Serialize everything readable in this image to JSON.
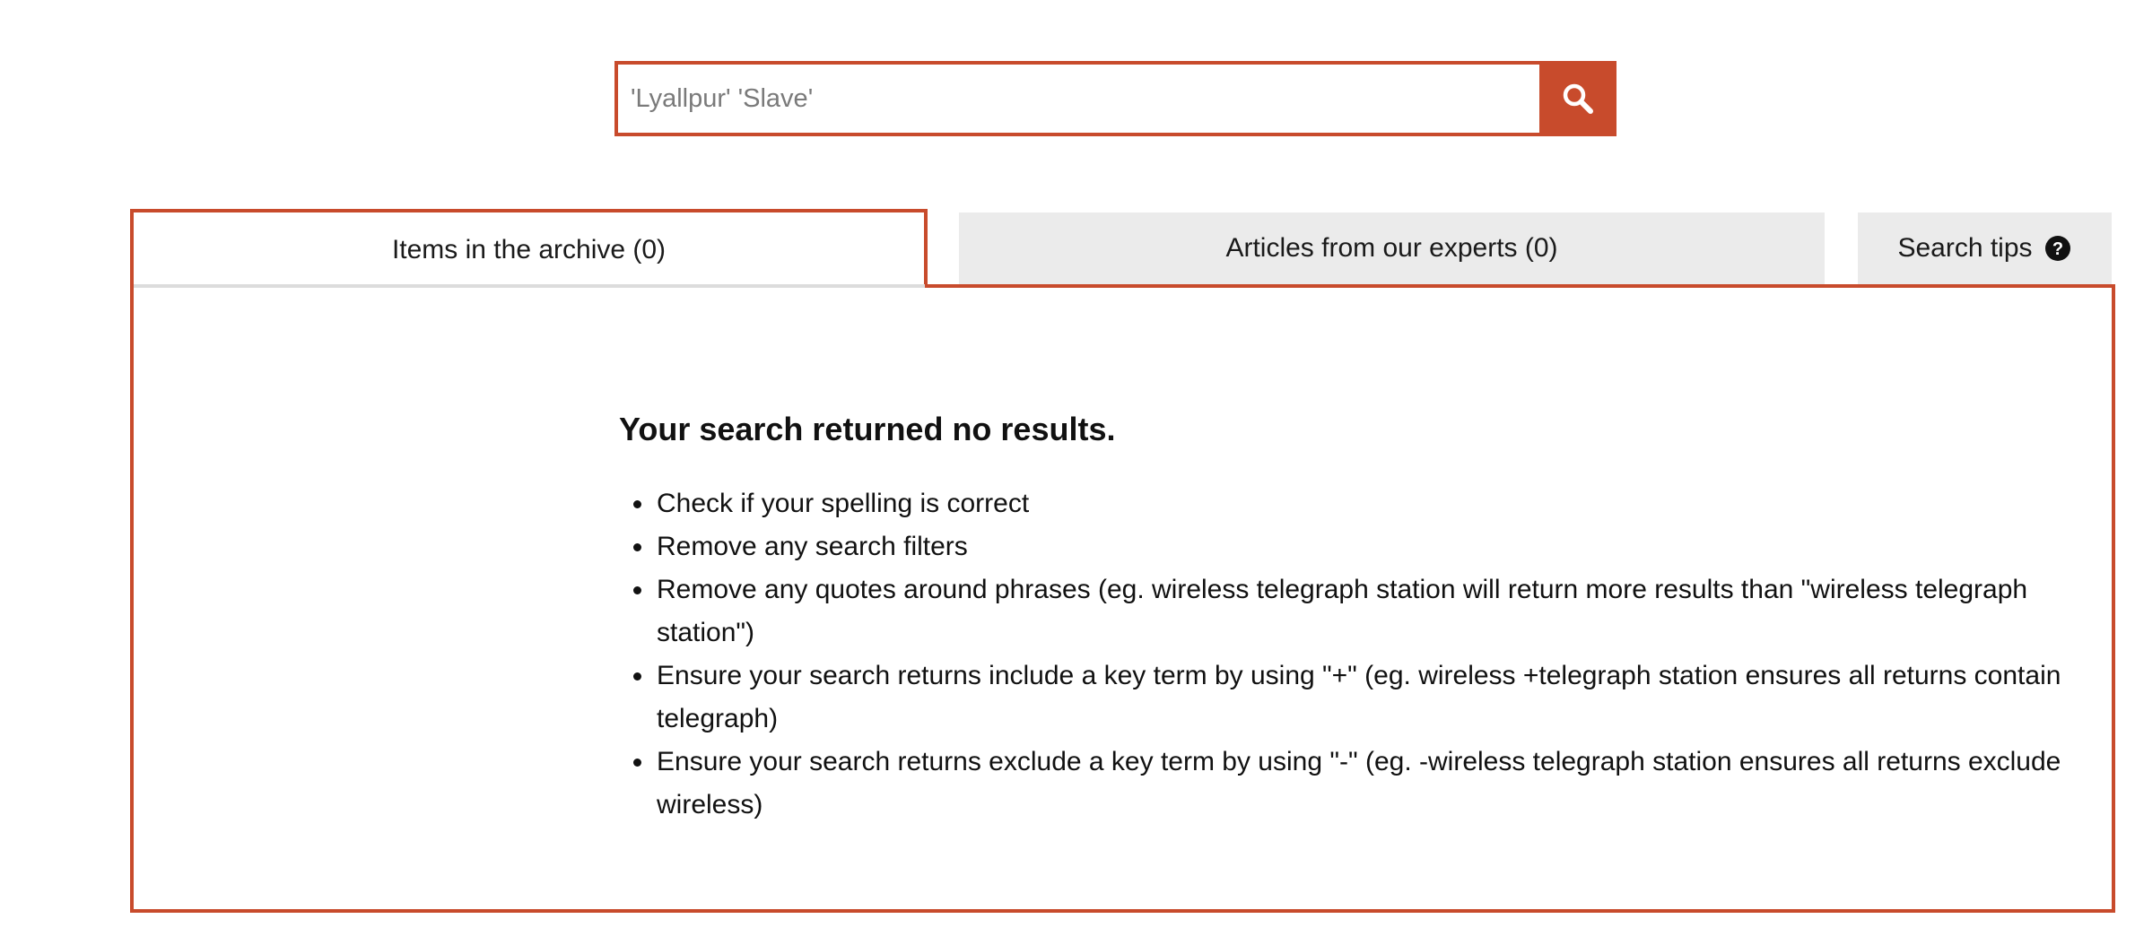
{
  "search": {
    "query": "",
    "placeholder": "'Lyallpur' 'Slave'",
    "button_icon": "search-icon"
  },
  "tabs": [
    {
      "label": "Items in the archive (0)",
      "active": true
    },
    {
      "label": "Articles from our experts (0)",
      "active": false
    },
    {
      "label": "Search tips",
      "icon": "question-circle-icon",
      "active": false
    }
  ],
  "results": {
    "message": "Your search returned no results.",
    "tips": [
      "Check if your spelling is correct",
      "Remove any search filters",
      "Remove any quotes around phrases (eg. wireless telegraph station will return more results than \"wireless telegraph station\")",
      "Ensure your search returns include a key term by using \"+\" (eg. wireless +telegraph station ensures all returns contain telegraph)",
      "Ensure your search returns exclude a key term by using \"-\" (eg. -wireless telegraph station ensures all returns exclude wireless)"
    ]
  },
  "colors": {
    "accent": "#c84b2c",
    "tab_inactive_bg": "#ebebeb",
    "text": "#111111"
  }
}
